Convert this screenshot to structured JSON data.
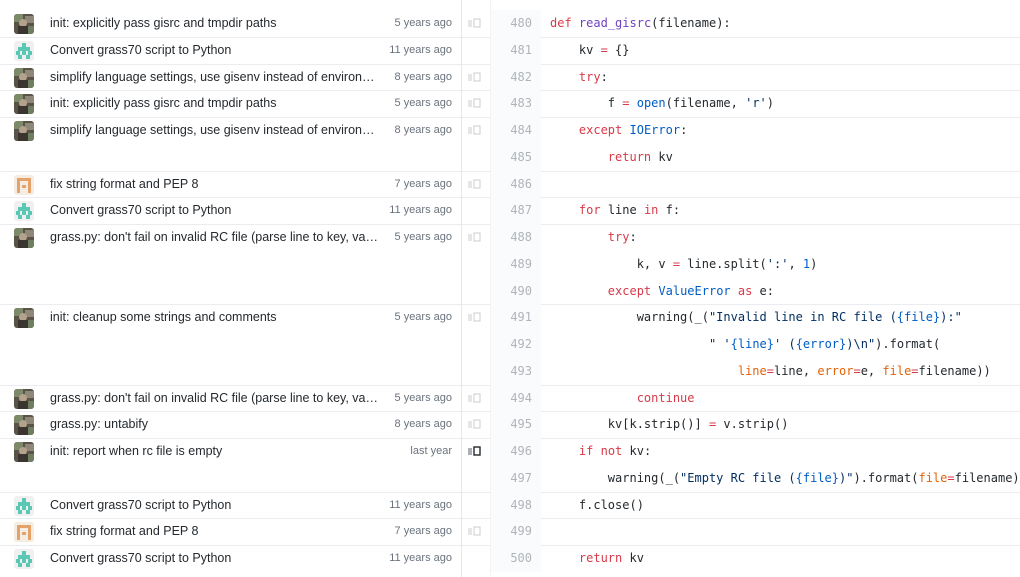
{
  "colors": {
    "accent_border": "#f1e6c9",
    "keyword": "#d73a49",
    "function": "#6f42c1",
    "string": "#032f62",
    "builtin": "#005cc5",
    "param": "#e36209"
  },
  "lines": [
    {
      "num": "480",
      "commit": {
        "avatar": "photo-avatar-icon",
        "message": "init: explicitly pass gisrc and tmpdir paths",
        "age": "5 years ago",
        "reblame": true
      },
      "tokens": [
        {
          "t": "kw",
          "v": "def"
        },
        {
          "t": "",
          "v": " "
        },
        {
          "t": "fn",
          "v": "read_gisrc"
        },
        {
          "t": "",
          "v": "(filename):"
        }
      ]
    },
    {
      "num": "481",
      "commit": {
        "avatar": "teal-identicon-icon",
        "message": "Convert grass70 script to Python",
        "age": "11 years ago",
        "reblame": false
      },
      "tokens": [
        {
          "t": "",
          "v": "    kv "
        },
        {
          "t": "kw",
          "v": "="
        },
        {
          "t": "",
          "v": " {}"
        }
      ]
    },
    {
      "num": "482",
      "commit": {
        "avatar": "photo-avatar-icon",
        "message": "simplify language settings, use gisenv instead of environment variables",
        "age": "8 years ago",
        "reblame": true
      },
      "tokens": [
        {
          "t": "",
          "v": "    "
        },
        {
          "t": "kw",
          "v": "try"
        },
        {
          "t": "",
          "v": ":"
        }
      ]
    },
    {
      "num": "483",
      "commit": {
        "avatar": "photo-avatar-icon",
        "message": "init: explicitly pass gisrc and tmpdir paths",
        "age": "5 years ago",
        "reblame": true
      },
      "tokens": [
        {
          "t": "",
          "v": "        f "
        },
        {
          "t": "kw",
          "v": "="
        },
        {
          "t": "",
          "v": " "
        },
        {
          "t": "nb",
          "v": "open"
        },
        {
          "t": "",
          "v": "(filename, "
        },
        {
          "t": "st",
          "v": "'r'"
        },
        {
          "t": "",
          "v": ")"
        }
      ]
    },
    {
      "num": "484",
      "commit": {
        "avatar": "photo-avatar-icon",
        "message": "simplify language settings, use gisenv instead of environment variables",
        "age": "8 years ago",
        "reblame": true
      },
      "tokens": [
        {
          "t": "",
          "v": "    "
        },
        {
          "t": "kw",
          "v": "except"
        },
        {
          "t": "",
          "v": " "
        },
        {
          "t": "nb",
          "v": "IOError"
        },
        {
          "t": "",
          "v": ":"
        }
      ]
    },
    {
      "num": "485",
      "commit": null,
      "tokens": [
        {
          "t": "",
          "v": "        "
        },
        {
          "t": "kw",
          "v": "return"
        },
        {
          "t": "",
          "v": " kv"
        }
      ]
    },
    {
      "num": "486",
      "commit": {
        "avatar": "orange-identicon-icon",
        "message": "fix string format and PEP 8",
        "age": "7 years ago",
        "reblame": true
      },
      "tokens": []
    },
    {
      "num": "487",
      "commit": {
        "avatar": "teal-identicon-icon",
        "message": "Convert grass70 script to Python",
        "age": "11 years ago",
        "reblame": false
      },
      "tokens": [
        {
          "t": "",
          "v": "    "
        },
        {
          "t": "kw",
          "v": "for"
        },
        {
          "t": "",
          "v": " line "
        },
        {
          "t": "kw",
          "v": "in"
        },
        {
          "t": "",
          "v": " f:"
        }
      ]
    },
    {
      "num": "488",
      "commit": {
        "avatar": "photo-avatar-icon",
        "message": "grass.py: don't fail on invalid RC file (parse line to key, value)",
        "age": "5 years ago",
        "reblame": true
      },
      "tokens": [
        {
          "t": "",
          "v": "        "
        },
        {
          "t": "kw",
          "v": "try"
        },
        {
          "t": "",
          "v": ":"
        }
      ]
    },
    {
      "num": "489",
      "commit": null,
      "tokens": [
        {
          "t": "",
          "v": "            k, v "
        },
        {
          "t": "kw",
          "v": "="
        },
        {
          "t": "",
          "v": " line.split("
        },
        {
          "t": "st",
          "v": "':'"
        },
        {
          "t": "",
          "v": ", "
        },
        {
          "t": "nb",
          "v": "1"
        },
        {
          "t": "",
          "v": ")"
        }
      ]
    },
    {
      "num": "490",
      "commit": null,
      "tokens": [
        {
          "t": "",
          "v": "        "
        },
        {
          "t": "kw",
          "v": "except"
        },
        {
          "t": "",
          "v": " "
        },
        {
          "t": "nb",
          "v": "ValueError"
        },
        {
          "t": "",
          "v": " "
        },
        {
          "t": "kw",
          "v": "as"
        },
        {
          "t": "",
          "v": " e:"
        }
      ]
    },
    {
      "num": "491",
      "commit": {
        "avatar": "photo-avatar-icon",
        "message": "init: cleanup some strings and comments",
        "age": "5 years ago",
        "reblame": true
      },
      "tokens": [
        {
          "t": "",
          "v": "            warning(_("
        },
        {
          "t": "st",
          "v": "\"Invalid line in RC file ("
        },
        {
          "t": "nb",
          "v": "{file}"
        },
        {
          "t": "st",
          "v": "):\""
        }
      ]
    },
    {
      "num": "492",
      "commit": null,
      "tokens": [
        {
          "t": "",
          "v": "                      "
        },
        {
          "t": "st",
          "v": "\" '"
        },
        {
          "t": "nb",
          "v": "{line}"
        },
        {
          "t": "st",
          "v": "' ("
        },
        {
          "t": "nb",
          "v": "{error}"
        },
        {
          "t": "st",
          "v": ")\\n\""
        },
        {
          "t": "",
          "v": ").format("
        }
      ]
    },
    {
      "num": "493",
      "commit": null,
      "tokens": [
        {
          "t": "",
          "v": "                          "
        },
        {
          "t": "pa",
          "v": "line"
        },
        {
          "t": "kw",
          "v": "="
        },
        {
          "t": "",
          "v": "line, "
        },
        {
          "t": "pa",
          "v": "error"
        },
        {
          "t": "kw",
          "v": "="
        },
        {
          "t": "",
          "v": "e, "
        },
        {
          "t": "pa",
          "v": "file"
        },
        {
          "t": "kw",
          "v": "="
        },
        {
          "t": "",
          "v": "filename))"
        }
      ]
    },
    {
      "num": "494",
      "commit": {
        "avatar": "photo-avatar-icon",
        "message": "grass.py: don't fail on invalid RC file (parse line to key, value)",
        "age": "5 years ago",
        "reblame": true
      },
      "tokens": [
        {
          "t": "",
          "v": "            "
        },
        {
          "t": "kw",
          "v": "continue"
        }
      ]
    },
    {
      "num": "495",
      "commit": {
        "avatar": "photo-avatar-icon",
        "message": "grass.py: untabify",
        "age": "8 years ago",
        "reblame": true
      },
      "tokens": [
        {
          "t": "",
          "v": "        kv[k.strip()] "
        },
        {
          "t": "kw",
          "v": "="
        },
        {
          "t": "",
          "v": " v.strip()"
        }
      ]
    },
    {
      "num": "496",
      "commit": {
        "avatar": "photo-avatar-icon",
        "message": "init: report when rc file is empty",
        "age": "last year",
        "reblame": true
      },
      "tokens": [
        {
          "t": "",
          "v": "    "
        },
        {
          "t": "kw",
          "v": "if"
        },
        {
          "t": "",
          "v": " "
        },
        {
          "t": "kw",
          "v": "not"
        },
        {
          "t": "",
          "v": " kv:"
        }
      ]
    },
    {
      "num": "497",
      "commit": null,
      "tokens": [
        {
          "t": "",
          "v": "        warning(_("
        },
        {
          "t": "st",
          "v": "\"Empty RC file ("
        },
        {
          "t": "nb",
          "v": "{file}"
        },
        {
          "t": "st",
          "v": ")\""
        },
        {
          "t": "",
          "v": ").format("
        },
        {
          "t": "pa",
          "v": "file"
        },
        {
          "t": "kw",
          "v": "="
        },
        {
          "t": "",
          "v": "filename))"
        }
      ]
    },
    {
      "num": "498",
      "commit": {
        "avatar": "teal-identicon-icon",
        "message": "Convert grass70 script to Python",
        "age": "11 years ago",
        "reblame": false
      },
      "tokens": [
        {
          "t": "",
          "v": "    f.close()"
        }
      ]
    },
    {
      "num": "499",
      "commit": {
        "avatar": "orange-identicon-icon",
        "message": "fix string format and PEP 8",
        "age": "7 years ago",
        "reblame": true
      },
      "tokens": []
    },
    {
      "num": "500",
      "commit": {
        "avatar": "teal-identicon-icon",
        "message": "Convert grass70 script to Python",
        "age": "11 years ago",
        "reblame": false
      },
      "tokens": [
        {
          "t": "",
          "v": "    "
        },
        {
          "t": "kw",
          "v": "return"
        },
        {
          "t": "",
          "v": " kv"
        }
      ]
    }
  ]
}
